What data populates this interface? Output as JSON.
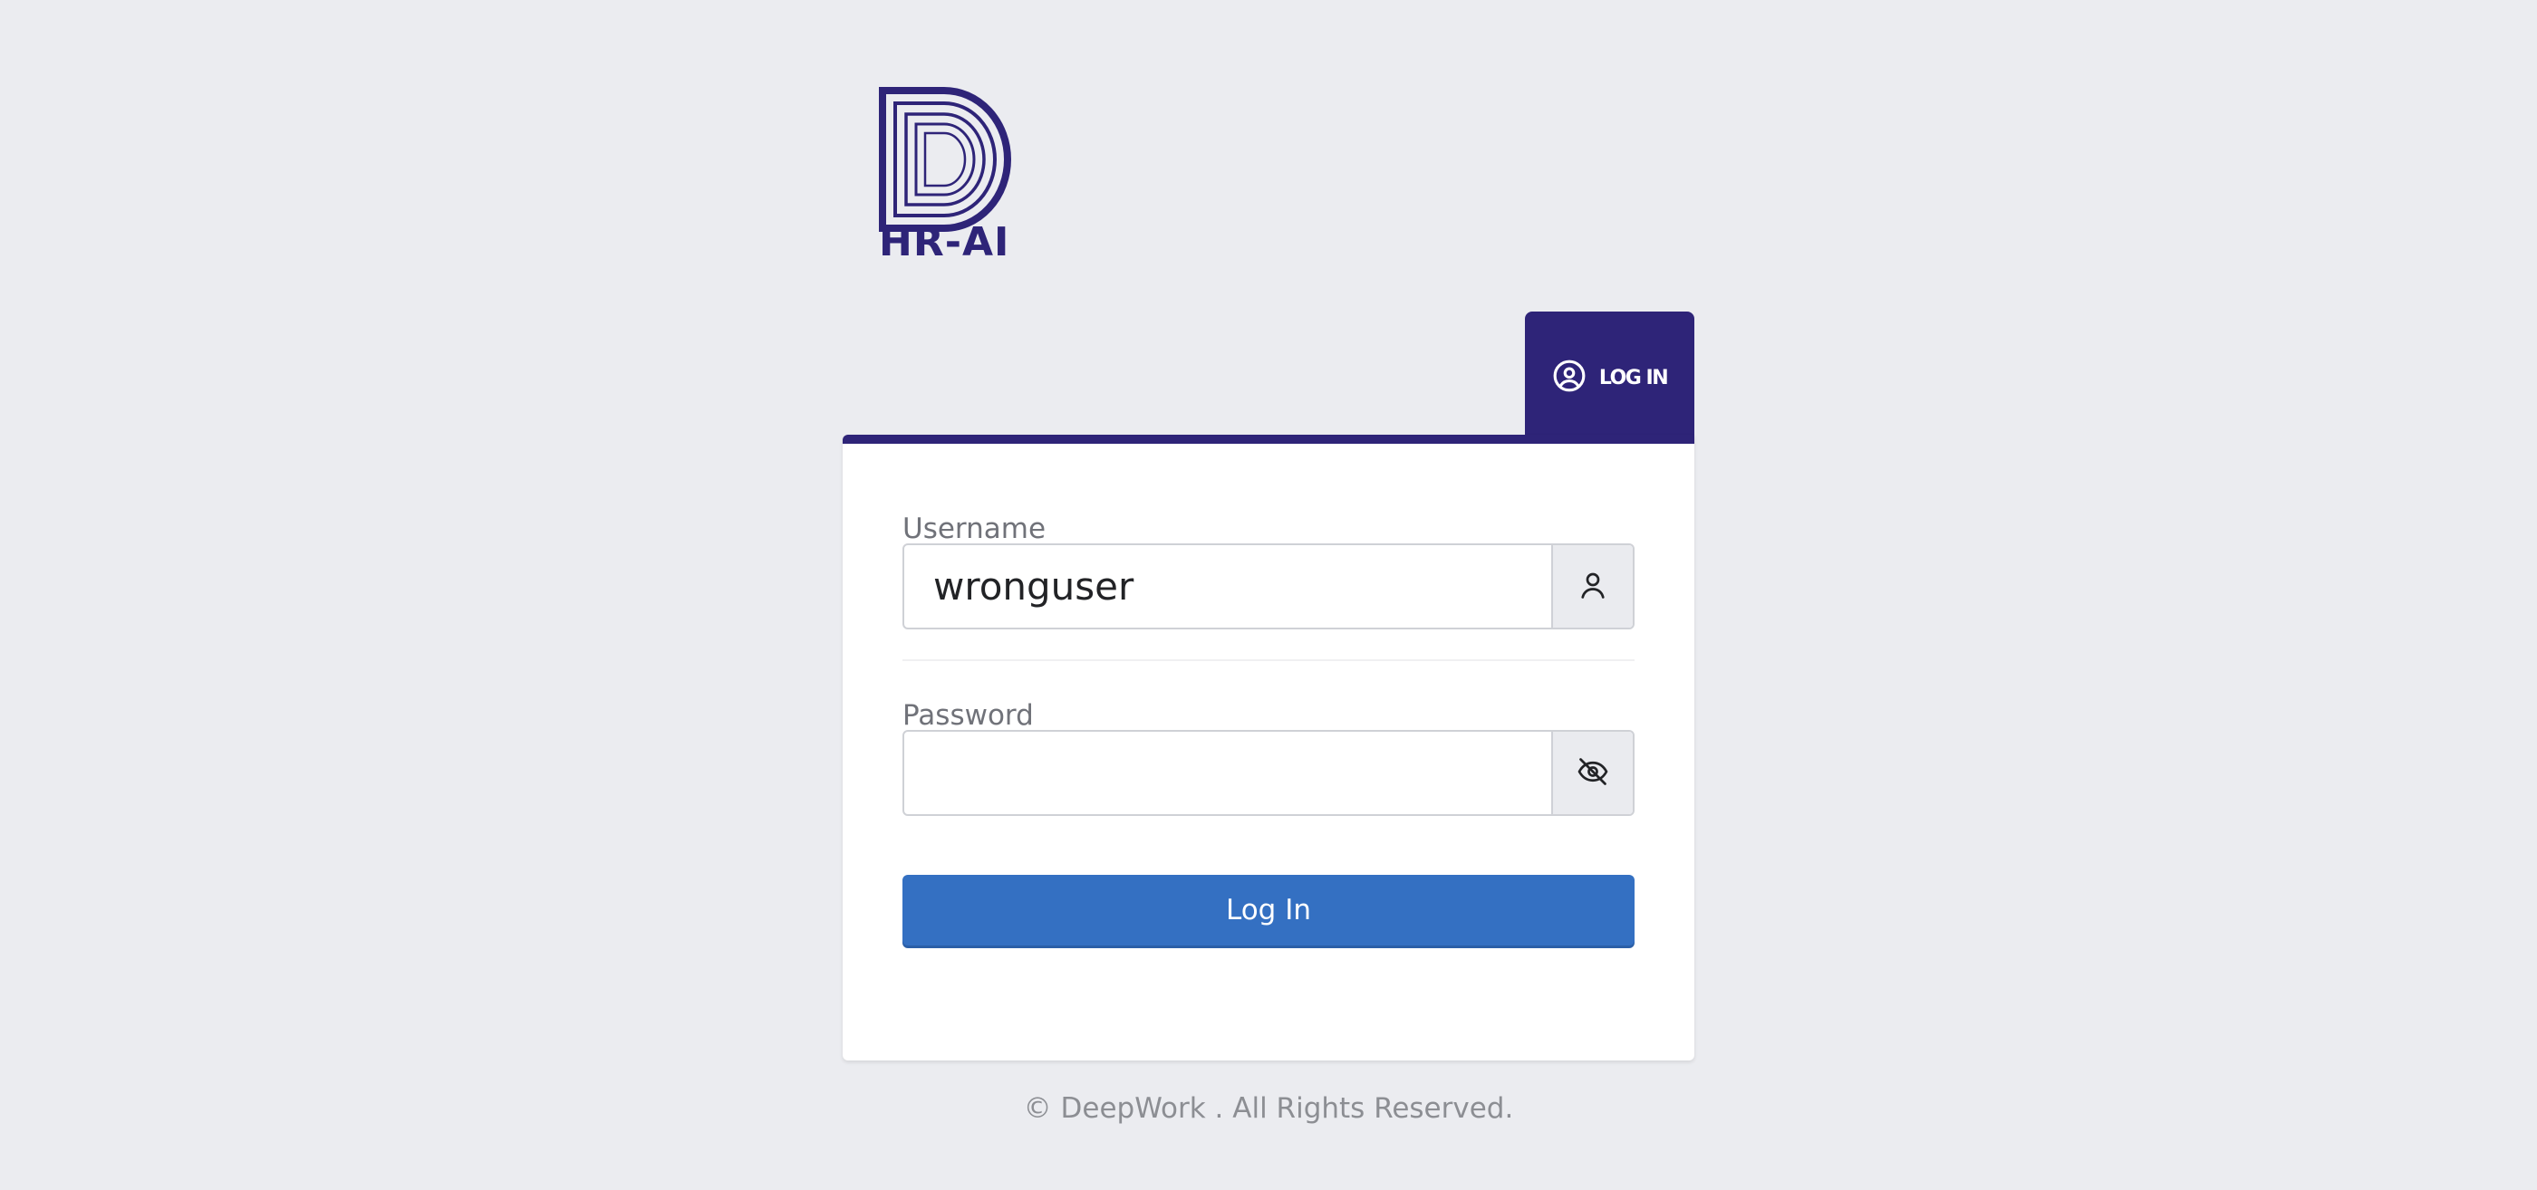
{
  "brand": {
    "logo_text": "HR-AI",
    "color": "#2e2478"
  },
  "tab": {
    "label": "LOG IN",
    "icon": "user-circle-icon"
  },
  "form": {
    "username": {
      "label": "Username",
      "value": "wronguser",
      "icon": "user-icon"
    },
    "password": {
      "label": "Password",
      "value": "",
      "icon": "eye-off-icon"
    },
    "submit_label": "Log In",
    "submit_color": "#3470c2"
  },
  "footer": {
    "text": "© DeepWork . All Rights Reserved."
  }
}
